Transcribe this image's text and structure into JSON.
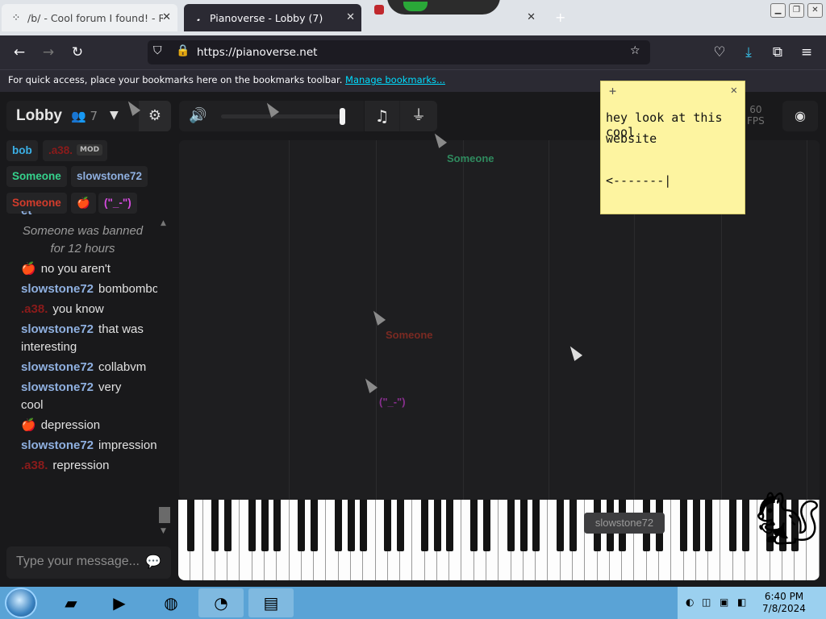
{
  "browser": {
    "tabs": [
      {
        "label": "/b/ - Cool forum I found! - Ran",
        "icon": "dots-favicon"
      },
      {
        "label": "Pianoverse - Lobby (7)",
        "icon": "pianoverse-favicon"
      },
      {
        "label": "",
        "icon": "game-favicon"
      }
    ],
    "url": "https://pianoverse.net",
    "bookmarks_prompt": "For quick access, place your bookmarks here on the bookmarks toolbar.",
    "manage_link": "Manage bookmarks..."
  },
  "lobby": {
    "name": "Lobby",
    "user_count": "7",
    "users": [
      {
        "name": "bob",
        "color": "#3bb0e6"
      },
      {
        "name": ".a38.",
        "color": "#8a1b1b",
        "badge": "MOD"
      },
      {
        "name": "Someone",
        "color": "#35d28c"
      },
      {
        "name": "slowstone72",
        "color": "#8fb0e0"
      },
      {
        "name": "Someone",
        "color": "#d23c2c"
      },
      {
        "name": "🍎",
        "color": "#d23c2c"
      },
      {
        "name": "(\"_-\")",
        "color": "#d64be0"
      }
    ]
  },
  "chat": {
    "messages": [
      {
        "name": "et",
        "text": "",
        "color": "#8fb0e0"
      },
      {
        "system": "Someone was banned for 12 hours"
      },
      {
        "name": "🍎",
        "text": "no you aren't",
        "color": "#d23c2c"
      },
      {
        "name": "slowstone72",
        "text": "bombombom",
        "color": "#8fb0e0"
      },
      {
        "name": ".a38.",
        "text": "you know",
        "color": "#8a1b1b"
      },
      {
        "name": "slowstone72",
        "text": "that was interesting",
        "color": "#8fb0e0"
      },
      {
        "name": "slowstone72",
        "text": "collabvm",
        "color": "#8fb0e0"
      },
      {
        "name": "slowstone72",
        "text": "very cool",
        "color": "#8fb0e0"
      },
      {
        "name": "🍎",
        "text": "depression",
        "color": "#d23c2c"
      },
      {
        "name": "slowstone72",
        "text": "impression",
        "color": "#8fb0e0"
      },
      {
        "name": ".a38.",
        "text": "repression",
        "color": "#8a1b1b"
      }
    ],
    "input_placeholder": "Type your message..."
  },
  "toolbar": {
    "volume_level": 1.0,
    "fps_value": "60",
    "fps_label": "FPS"
  },
  "cursors": [
    {
      "label": "Someone",
      "color": "#2f8a5e"
    },
    {
      "label": "Someone",
      "color": "#7a2a22"
    },
    {
      "label": "(\"_-\")",
      "color": "#8a2f90"
    },
    {
      "label": "slowstone72",
      "color": "#8d8d8d"
    }
  ],
  "sticky_note": {
    "line1": "hey look at this cool",
    "line2": "website",
    "line3": "<-------|"
  },
  "taskbar": {
    "time": "6:40 PM",
    "date": "7/8/2024"
  }
}
